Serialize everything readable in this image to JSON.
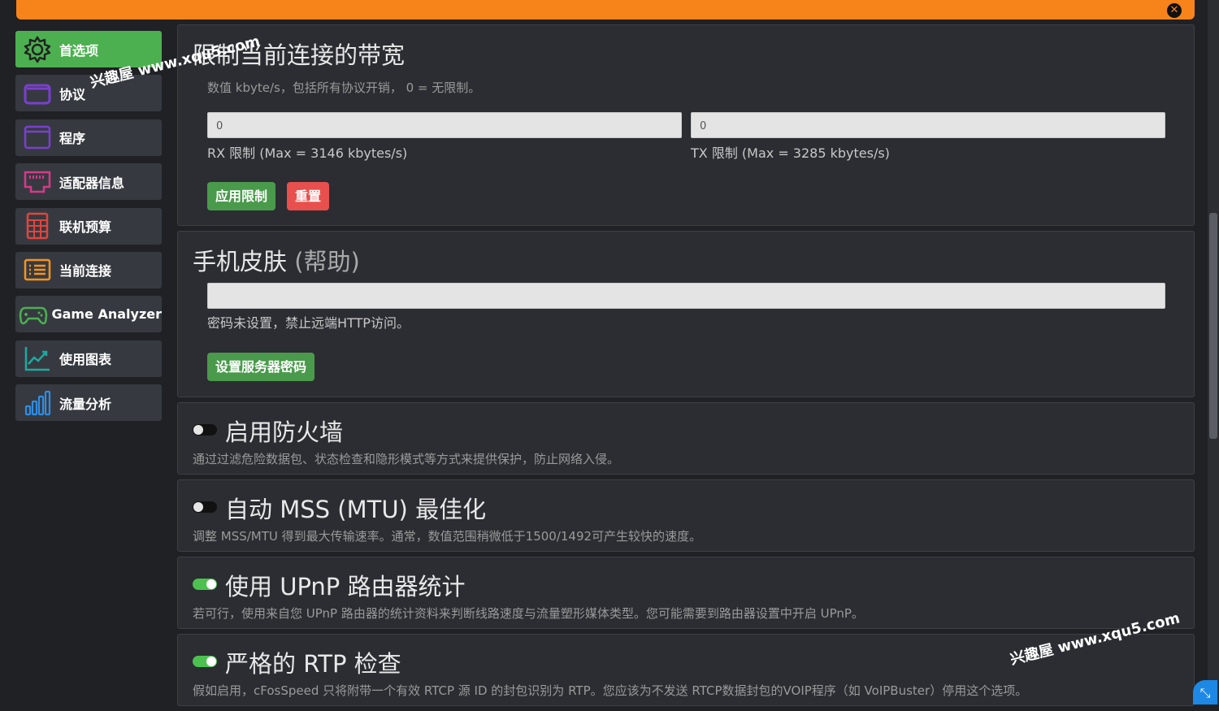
{
  "window": {
    "close_icon": "close-icon"
  },
  "sidebar": {
    "items": [
      {
        "label": "首选项",
        "icon": "gear-icon",
        "active": true
      },
      {
        "label": "协议",
        "icon": "folder-icon"
      },
      {
        "label": "程序",
        "icon": "window-icon"
      },
      {
        "label": "适配器信息",
        "icon": "network-port-icon"
      },
      {
        "label": "联机预算",
        "icon": "calculator-icon"
      },
      {
        "label": "当前连接",
        "icon": "list-icon"
      },
      {
        "label": "Game Analyzer",
        "icon": "gamepad-icon"
      },
      {
        "label": "使用图表",
        "icon": "line-chart-icon"
      },
      {
        "label": "流量分析",
        "icon": "bar-chart-icon"
      }
    ]
  },
  "bandwidth": {
    "title": "限制当前连接的带宽",
    "hint": "数值 kbyte/s，包括所有协议开销， 0 = 无限制。",
    "rx_value": "0",
    "tx_value": "0",
    "rx_label": "RX 限制 (Max = 3146 kbytes/s)",
    "tx_label": "TX 限制 (Max = 3285 kbytes/s)",
    "apply_label": "应用限制",
    "reset_label": "重置"
  },
  "skin": {
    "title": "手机皮肤",
    "help": "(帮助)",
    "password_value": "",
    "hint": "密码未设置，禁止远端HTTP访问。",
    "set_password_label": "设置服务器密码"
  },
  "options": [
    {
      "title": "启用防火墙",
      "desc": "通过过滤危险数据包、状态检查和隐形模式等方式来提供保护，防止网络入侵。",
      "enabled": false
    },
    {
      "title": "自动 MSS (MTU) 最佳化",
      "desc": "调整 MSS/MTU 得到最大传输速率。通常，数值范围稍微低于1500/1492可产生较快的速度。",
      "enabled": false
    },
    {
      "title": "使用 UPnP 路由器统计",
      "desc": "若可行，使用来自您 UPnP 路由器的统计资料来判断线路速度与流量塑形媒体类型。您可能需要到路由器设置中开启 UPnP。",
      "enabled": true
    },
    {
      "title": "严格的 RTP 检查",
      "desc": "假如启用，cFosSpeed 只将附带一个有效 RTCP 源 ID 的封包识别为 RTP。您应该为不发送 RTCP数据封包的VOIP程序（如 VoIPBuster）停用这个选项。",
      "enabled": true
    }
  ],
  "watermark": {
    "text1": "兴趣屋 www.xqu5.com",
    "text2": "兴趣屋 www.xqu5.com"
  },
  "colors": {
    "accent": "#f7841a",
    "active_green": "#4cb050",
    "danger": "#e8504d",
    "toggle_on": "#4cc150"
  }
}
